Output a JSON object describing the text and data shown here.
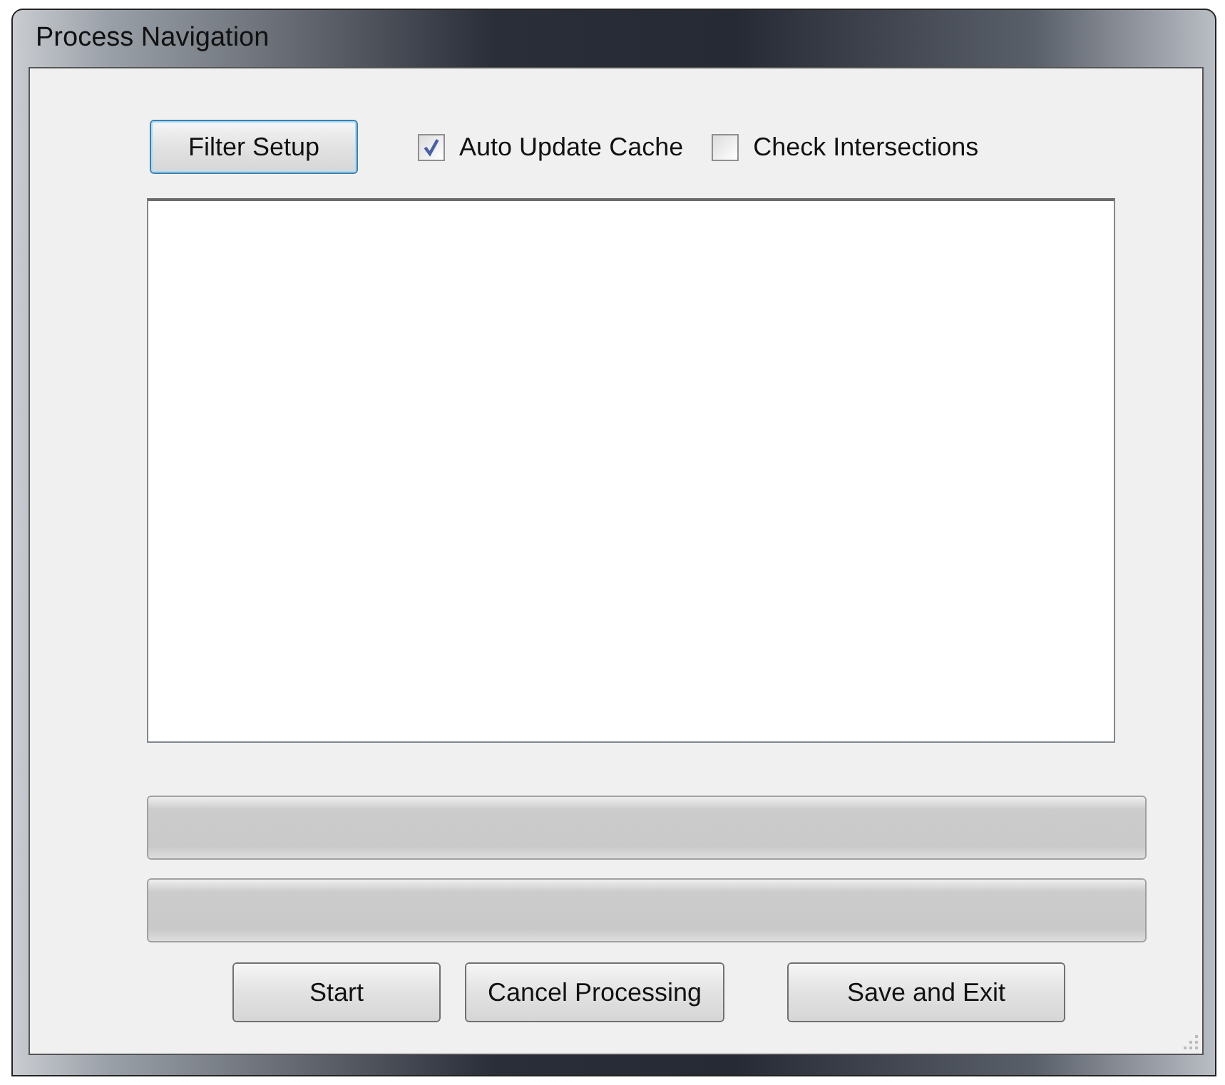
{
  "window": {
    "title": "Process Navigation"
  },
  "filter_button": "Filter Setup",
  "checkboxes": [
    {
      "label": "Auto Update Cache",
      "checked": true
    },
    {
      "label": "Check Intersections",
      "checked": false
    }
  ],
  "progress_bars": [
    {
      "level": 0
    },
    {
      "level": 0
    }
  ],
  "buttons": [
    "Start",
    "Cancel Processing",
    "Save and Exit"
  ]
}
